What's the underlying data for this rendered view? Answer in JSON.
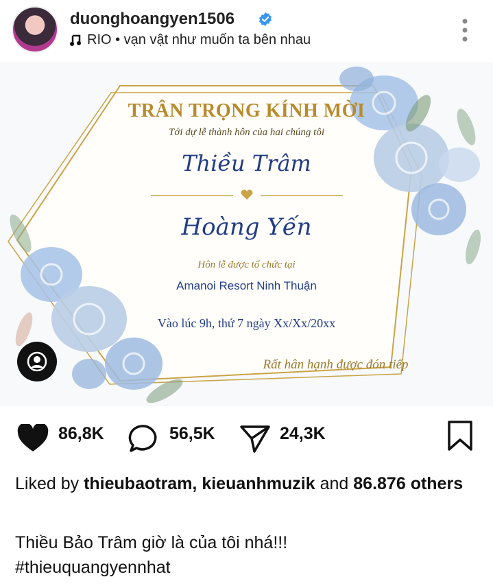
{
  "header": {
    "username": "duonghoangyen1506",
    "music_title": "RIO • vạn vật như muốn ta bên nhau"
  },
  "invitation": {
    "heading": "TRÂN TRỌNG KÍNH MỜI",
    "subheading": "Tới dự lễ thành hôn của hai chúng tôi",
    "name_1": "Thiều Trâm",
    "name_2": "Hoàng Yến",
    "venue_intro": "Hôn lễ được tổ chức tại",
    "venue": "Amanoi Resort Ninh Thuận",
    "time": "Vào lúc 9h, thứ 7 ngày Xx/Xx/20xx",
    "closing": "Rất hân hạnh được đón tiếp"
  },
  "actions": {
    "likes": "86,8K",
    "comments": "56,5K",
    "shares": "24,3K"
  },
  "liked_by": {
    "prefix": "Liked by",
    "users": "thieubaotram, kieuanhmuzik",
    "and": "and",
    "count": "86.876",
    "others": "others"
  },
  "caption": {
    "text": "Thiều Bảo Trâm giờ là của tôi nhá!!!",
    "hashtag": "#thieuquangyennhat"
  },
  "colors": {
    "gold": "#c9a445",
    "navy": "#213c86",
    "rose_blue": "#9dbbe0",
    "verified": "#3897f0"
  }
}
